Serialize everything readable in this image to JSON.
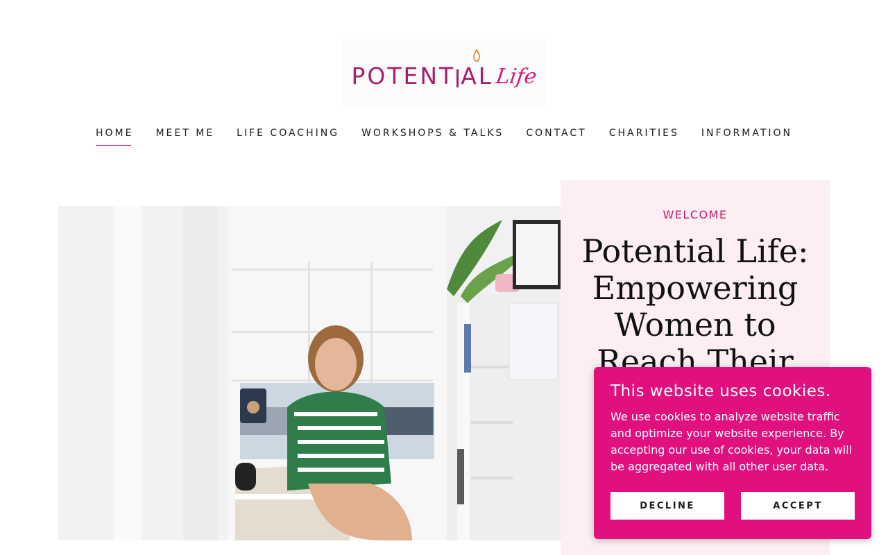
{
  "logo": {
    "main": "POTENT",
    "main2": "AL",
    "script": "Life"
  },
  "nav": {
    "items": [
      {
        "label": "HOME"
      },
      {
        "label": "MEET ME"
      },
      {
        "label": "LIFE COACHING"
      },
      {
        "label": "WORKSHOPS & TALKS"
      },
      {
        "label": "CONTACT"
      },
      {
        "label": "CHARITIES"
      },
      {
        "label": "INFORMATION"
      }
    ],
    "active": "HOME"
  },
  "hero": {
    "eyebrow": "WELCOME",
    "headline": "Potential Life: Empowering Women to Reach Their"
  },
  "cookie": {
    "title": "This website uses cookies.",
    "body": "We use cookies to analyze website traffic and optimize your website experience. By accepting our use of cookies, your data will be aggregated with all other user data.",
    "decline": "DECLINE",
    "accept": "ACCEPT"
  },
  "colors": {
    "accent": "#e0117f",
    "card_bg": "#fdeef2",
    "logo_primary": "#a51f6d"
  }
}
